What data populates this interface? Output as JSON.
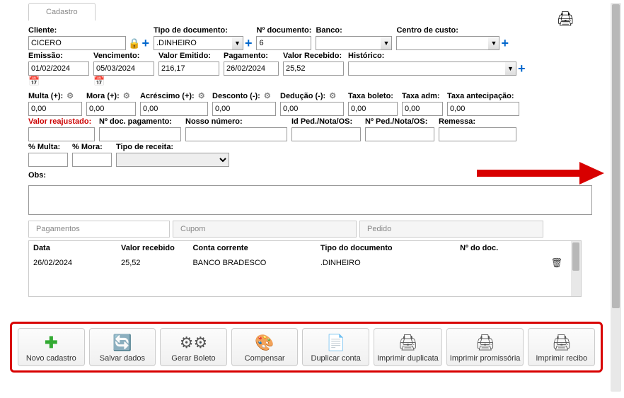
{
  "tabs": {
    "cadastro": "Cadastro"
  },
  "top_row": {
    "cliente_label": "Cliente:",
    "cliente_value": "CICERO",
    "tipo_doc_label": "Tipo de documento:",
    "tipo_doc_value": ".DINHEIRO",
    "n_doc_label": "Nº documento:",
    "n_doc_value": "6",
    "banco_label": "Banco:",
    "banco_value": "",
    "centro_label": "Centro de custo:",
    "centro_value": ""
  },
  "dates_row": {
    "emissao_label": "Emissão:",
    "emissao_value": "01/02/2024",
    "vencimento_label": "Vencimento:",
    "vencimento_value": "05/03/2024",
    "valor_emitido_label": "Valor Emitido:",
    "valor_emitido_value": "216,17",
    "pagamento_label": "Pagamento:",
    "pagamento_value": "26/02/2024",
    "valor_recebido_label": "Valor Recebido:",
    "valor_recebido_value": "25,52",
    "historico_label": "Histórico:",
    "historico_value": ""
  },
  "multa_row": {
    "multa_label": "Multa (+):",
    "multa_value": "0,00",
    "mora_label": "Mora (+):",
    "mora_value": "0,00",
    "acrescimo_label": "Acréscimo (+):",
    "acrescimo_value": "0,00",
    "desconto_label": "Desconto (-):",
    "desconto_value": "0,00",
    "deducao_label": "Dedução (-):",
    "deducao_value": "0,00",
    "taxa_boleto_label": "Taxa boleto:",
    "taxa_boleto_value": "0,00",
    "taxa_adm_label": "Taxa adm:",
    "taxa_adm_value": "0,00",
    "taxa_antec_label": "Taxa antecipação:",
    "taxa_antec_value": "0,00"
  },
  "reajust_row": {
    "valor_reaj_label": "Valor reajustado:",
    "valor_reaj_value": "",
    "n_doc_pag_label": "Nº doc. pagamento:",
    "n_doc_pag_value": "",
    "nosso_num_label": "Nosso número:",
    "nosso_num_value": "",
    "id_ped_label": "Id Ped./Nota/OS:",
    "id_ped_value": "",
    "n_ped_label": "Nº Ped./Nota/OS:",
    "n_ped_value": "",
    "remessa_label": "Remessa:",
    "remessa_value": ""
  },
  "pct_row": {
    "pct_multa_label": "% Multa:",
    "pct_multa_value": "",
    "pct_mora_label": "% Mora:",
    "pct_mora_value": "",
    "tipo_receita_label": "Tipo de receita:",
    "tipo_receita_value": ""
  },
  "obs_label": "Obs:",
  "obs_value": "",
  "sub_tabs": {
    "pagamentos": "Pagamentos",
    "cupom": "Cupom",
    "pedido": "Pedido"
  },
  "table": {
    "headers": {
      "data": "Data",
      "valor": "Valor recebido",
      "conta": "Conta corrente",
      "tipo": "Tipo do documento",
      "ndoc": "Nº do doc."
    },
    "rows": [
      {
        "data": "26/02/2024",
        "valor": "25,52",
        "conta": "BANCO BRADESCO",
        "tipo": ".DINHEIRO",
        "ndoc": ""
      }
    ]
  },
  "toolbar": {
    "novo": "Novo cadastro",
    "salvar": "Salvar dados",
    "gerar": "Gerar Boleto",
    "compensar": "Compensar",
    "duplicar": "Duplicar conta",
    "imp_dup": "Imprimir duplicata",
    "imp_prom": "Imprimir promissória",
    "imp_rec": "Imprimir recibo"
  }
}
